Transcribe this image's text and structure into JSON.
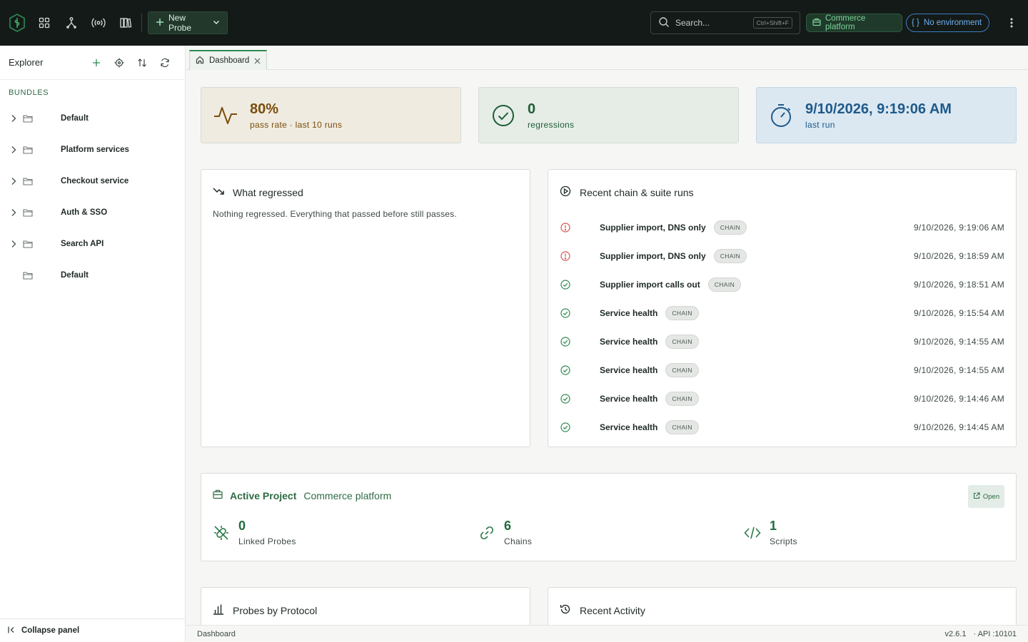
{
  "topbar": {
    "new_probe_label": "New Probe",
    "search_placeholder": "Search...",
    "search_shortcut": "Ctrl+Shift+F",
    "project_pill": "Commerce platform",
    "environment_pill": "No environment",
    "environment_icon": "{ }"
  },
  "sidebar": {
    "title": "Explorer",
    "section_label": "BUNDLES",
    "items": [
      {
        "label": "Default",
        "expandable": true
      },
      {
        "label": "Platform services",
        "expandable": true
      },
      {
        "label": "Checkout service",
        "expandable": true
      },
      {
        "label": "Auth & SSO",
        "expandable": true
      },
      {
        "label": "Search API",
        "expandable": true
      },
      {
        "label": "Default",
        "expandable": false
      }
    ],
    "collapse_label": "Collapse panel"
  },
  "tabs": [
    {
      "label": "Dashboard",
      "active": true
    }
  ],
  "stats": {
    "pass_rate": {
      "value": "80%",
      "label": "pass rate · last 10 runs"
    },
    "regressions": {
      "value": "0",
      "label": "regressions"
    },
    "last_run": {
      "value": "9/10/2026, 9:19:06 AM",
      "label": "last run"
    }
  },
  "regressed": {
    "title": "What regressed",
    "message": "Nothing regressed. Everything that passed before still passes."
  },
  "runs": {
    "title": "Recent chain & suite runs",
    "items": [
      {
        "name": "Supplier import, DNS only",
        "kind": "CHAIN",
        "status": "error",
        "time": "9/10/2026, 9:19:06 AM"
      },
      {
        "name": "Supplier import, DNS only",
        "kind": "CHAIN",
        "status": "error",
        "time": "9/10/2026, 9:18:59 AM"
      },
      {
        "name": "Supplier import calls out",
        "kind": "CHAIN",
        "status": "ok",
        "time": "9/10/2026, 9:18:51 AM"
      },
      {
        "name": "Service health",
        "kind": "CHAIN",
        "status": "ok",
        "time": "9/10/2026, 9:15:54 AM"
      },
      {
        "name": "Service health",
        "kind": "CHAIN",
        "status": "ok",
        "time": "9/10/2026, 9:14:55 AM"
      },
      {
        "name": "Service health",
        "kind": "CHAIN",
        "status": "ok",
        "time": "9/10/2026, 9:14:55 AM"
      },
      {
        "name": "Service health",
        "kind": "CHAIN",
        "status": "ok",
        "time": "9/10/2026, 9:14:46 AM"
      },
      {
        "name": "Service health",
        "kind": "CHAIN",
        "status": "ok",
        "time": "9/10/2026, 9:14:45 AM"
      }
    ]
  },
  "project": {
    "label": "Active Project",
    "name": "Commerce platform",
    "open_label": "Open",
    "metrics": [
      {
        "value": "0",
        "label": "Linked Probes",
        "icon": "unlink-icon"
      },
      {
        "value": "6",
        "label": "Chains",
        "icon": "link-icon"
      },
      {
        "value": "1",
        "label": "Scripts",
        "icon": "code-icon"
      }
    ]
  },
  "protocol": {
    "title": "Probes by Protocol"
  },
  "activity": {
    "title": "Recent Activity"
  },
  "statusbar": {
    "left": "Dashboard",
    "version": "v2.6.1",
    "api": "· API :10101"
  },
  "colors": {
    "brand": "#2e8a52",
    "error": "#d9534f",
    "ok": "#2e8a52",
    "topbar_bg": "#141a17"
  }
}
